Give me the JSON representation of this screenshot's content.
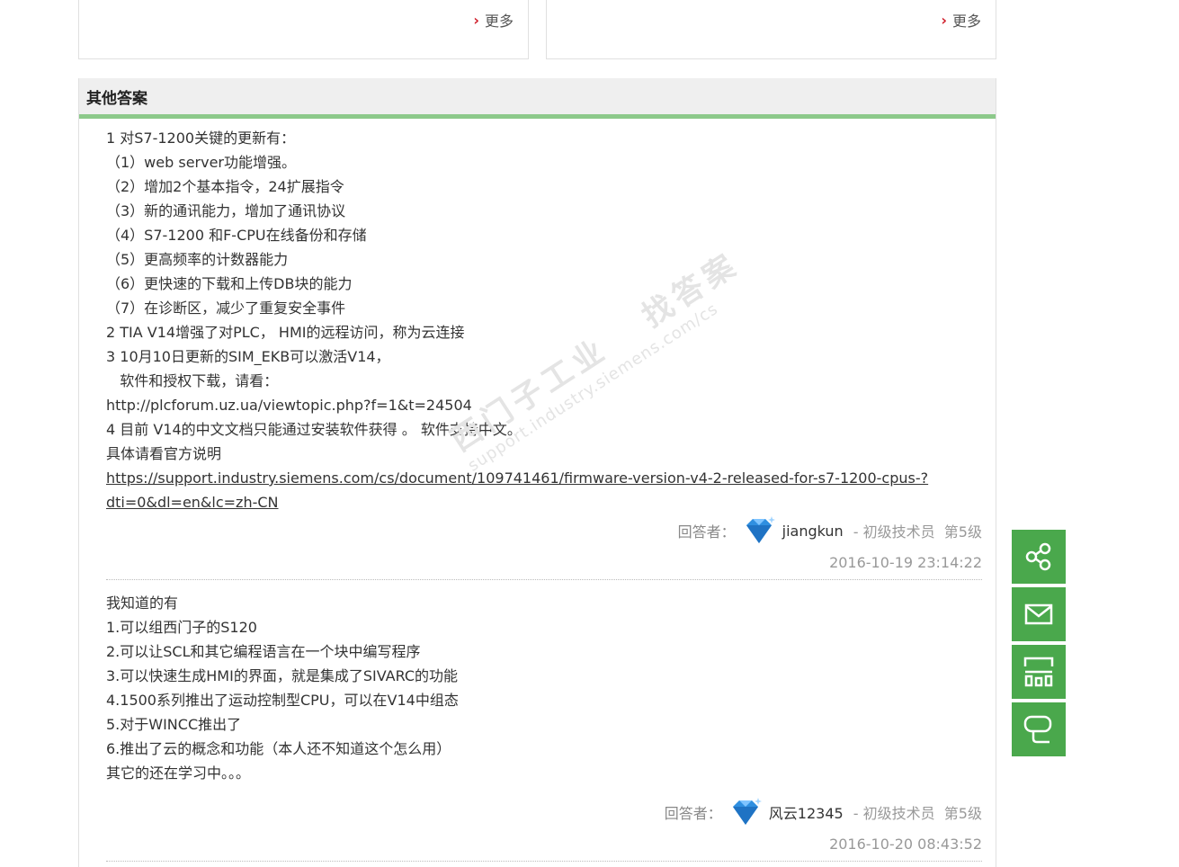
{
  "top_boxes": [
    {
      "more_label": "更多"
    },
    {
      "more_label": "更多"
    }
  ],
  "section": {
    "title": "其他答案"
  },
  "answers": [
    {
      "lines": [
        "1 对S7-1200关键的更新有：",
        "（1）web server功能增强。",
        "（2）增加2个基本指令，24扩展指令",
        "（3）新的通讯能力，增加了通讯协议",
        "（4）S7-1200 和F-CPU在线备份和存储",
        "（5）更高频率的计数器能力",
        "（6）更快速的下载和上传DB块的能力",
        "（7）在诊断区，减少了重复安全事件",
        "2 TIA V14增强了对PLC， HMI的远程访问，称为云连接",
        "3 10月10日更新的SIM_EKB可以激活V14，",
        "   软件和授权下载，请看：",
        "http://plcforum.uz.ua/viewtopic.php?f=1&t=24504",
        "4 目前 V14的中文文档只能通过安装软件获得 。 软件支持中文。",
        "具体请看官方说明"
      ],
      "link_lines": [
        "https://support.industry.siemens.com/cs/document/109741461/firmware-version-v4-2-released-for-s7-1200-cpus-?",
        "dti=0&dl=en&lc=zh-CN"
      ],
      "answerer_label": "回答者：",
      "name": "jiangkun",
      "level": " - 初级技术员  第5级",
      "time": "2016-10-19 23:14:22"
    },
    {
      "lines": [
        "我知道的有",
        "1.可以组西门子的S120",
        "2.可以让SCL和其它编程语言在一个块中编写程序",
        "3.可以快速生成HMI的界面，就是集成了SIVARC的功能",
        "4.1500系列推出了运动控制型CPU，可以在V14中组态",
        "5.对于WINCC推出了",
        "6.推出了云的概念和功能（本人还不知道这个怎么用）",
        "其它的还在学习中。。。"
      ],
      "answerer_label": "回答者：",
      "name": "风云12345",
      "level": " - 初级技术员  第5级",
      "time": "2016-10-20 08:43:52"
    }
  ],
  "watermark": {
    "line1": "西门子工业   找答案",
    "line2": "support.industry.siemens.com/cs"
  },
  "side_tools": [
    "share-icon",
    "mail-icon",
    "qrcode-icon",
    "feedback-icon"
  ],
  "colors": {
    "accent_green": "#4aa84c",
    "header_border": "#8cc98a",
    "chevron_red": "#d0202c",
    "gem_blue": "#2f8fe0"
  }
}
